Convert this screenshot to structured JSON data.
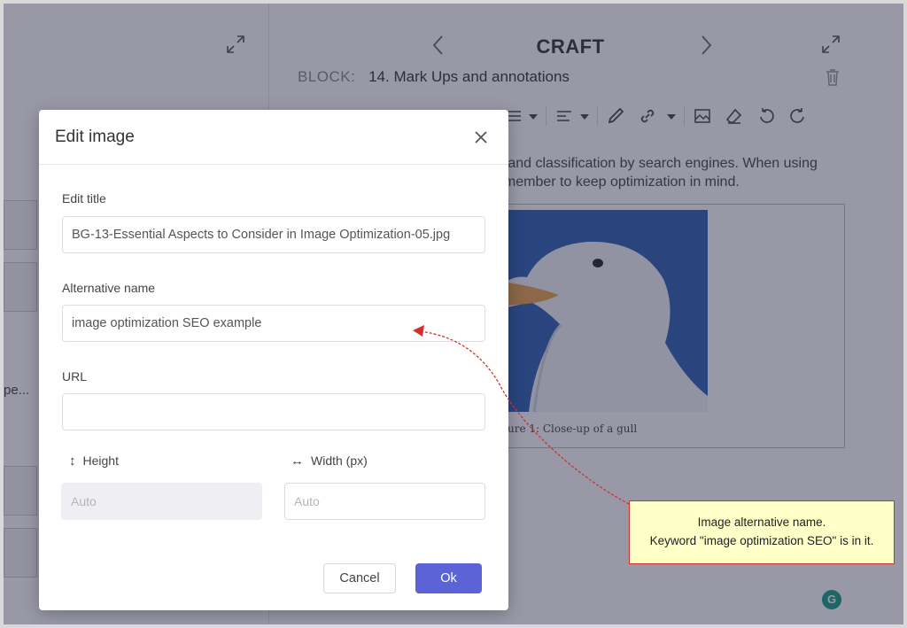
{
  "app": {
    "page_title": "CRAFT",
    "block_key": "BLOCK:",
    "block_name": "14. Mark Ups and annotations",
    "left_truncated_text": "pe...",
    "body_text_line1": "g and classification by search engines.  When using",
    "body_text_line2": "emember to keep optimization in mind.",
    "figure_caption": "ure 1: Close-up of a gull",
    "grammarly_badge": "G"
  },
  "icons": {
    "left_expand": "expand-arrows-icon",
    "prev": "chevron-left-icon",
    "next": "chevron-right-icon",
    "right_expand": "expand-arrows-icon",
    "trash": "trash-icon",
    "toolbar": [
      "list-icon",
      "align-icon",
      "pen-icon",
      "link-icon",
      "image-icon",
      "eraser-icon",
      "undo-icon",
      "redo-icon"
    ]
  },
  "dialog": {
    "title": "Edit image",
    "edit_title_label": "Edit title",
    "edit_title_value": "BG-13-Essential Aspects to Consider in Image Optimization-05.jpg",
    "alt_label": "Alternative name",
    "alt_value": "image optimization SEO example",
    "url_label": "URL",
    "url_value": "",
    "height_label": "Height",
    "height_placeholder": "Auto",
    "width_label": "Width (px)",
    "width_placeholder": "Auto",
    "cancel_label": "Cancel",
    "ok_label": "Ok"
  },
  "annotation": {
    "line1": "Image alternative name.",
    "line2": "Keyword \"image optimization SEO\" is in it."
  },
  "colors": {
    "primary_button": "#5b63d6",
    "overlay": "rgba(40,40,72,0.48)",
    "annotation_border": "#d0312d",
    "annotation_fill": "#ffffc8"
  }
}
